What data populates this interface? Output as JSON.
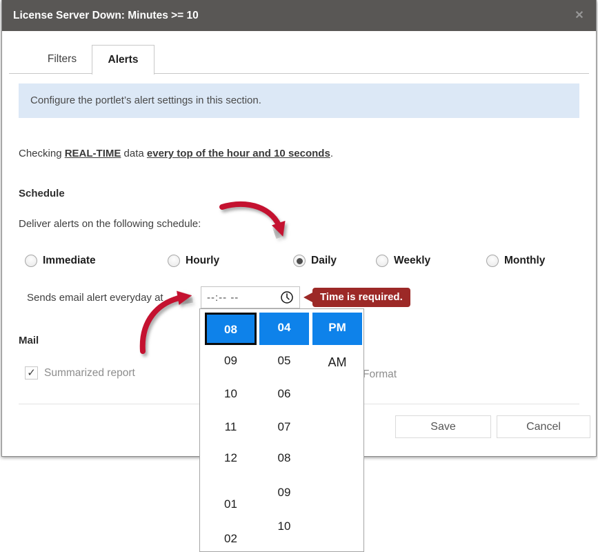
{
  "window": {
    "title": "License Server Down: Minutes >= 10",
    "close_glyph": "✕"
  },
  "tabs": [
    {
      "label": "Filters"
    },
    {
      "label": "Alerts"
    }
  ],
  "banner": {
    "text": "Configure the portlet’s alert settings in this section."
  },
  "checking_line": {
    "prefix": "Checking ",
    "realtime": "REAL-TIME",
    "middle": " data ",
    "frequency": "every top of the hour and 10 seconds",
    "suffix": "."
  },
  "schedule": {
    "heading": "Schedule",
    "description": "Deliver alerts on the following schedule:",
    "options": [
      {
        "label": "Immediate",
        "selected": false
      },
      {
        "label": "Hourly",
        "selected": false
      },
      {
        "label": "Daily",
        "selected": true
      },
      {
        "label": "Weekly",
        "selected": false
      },
      {
        "label": "Monthly",
        "selected": false
      }
    ],
    "sends_label": "Sends email alert everyday at",
    "time_input": {
      "value": "--:-- --",
      "icon": "clock-icon"
    },
    "validation_message": "Time is required."
  },
  "mail": {
    "heading": "Mail",
    "summarized_label": "Summarized report",
    "summarized_checked": true,
    "check_glyph": "✓",
    "format_label": "Format"
  },
  "footer": {
    "save_label": "Save",
    "cancel_label": "Cancel"
  },
  "timepicker": {
    "hours": {
      "selected": "08",
      "items": [
        "09",
        "10",
        "11",
        "12",
        "01",
        "02"
      ]
    },
    "minutes": {
      "selected": "04",
      "items": [
        "05",
        "06",
        "07",
        "08",
        "09",
        "10"
      ]
    },
    "meridiem": {
      "selected": "PM",
      "items": [
        "AM"
      ]
    }
  },
  "colors": {
    "titlebar": "#595755",
    "accent_blue": "#0e82ea",
    "error_red": "#9c2927",
    "arrow_red": "#c41230",
    "banner_bg": "#dce8f6"
  }
}
